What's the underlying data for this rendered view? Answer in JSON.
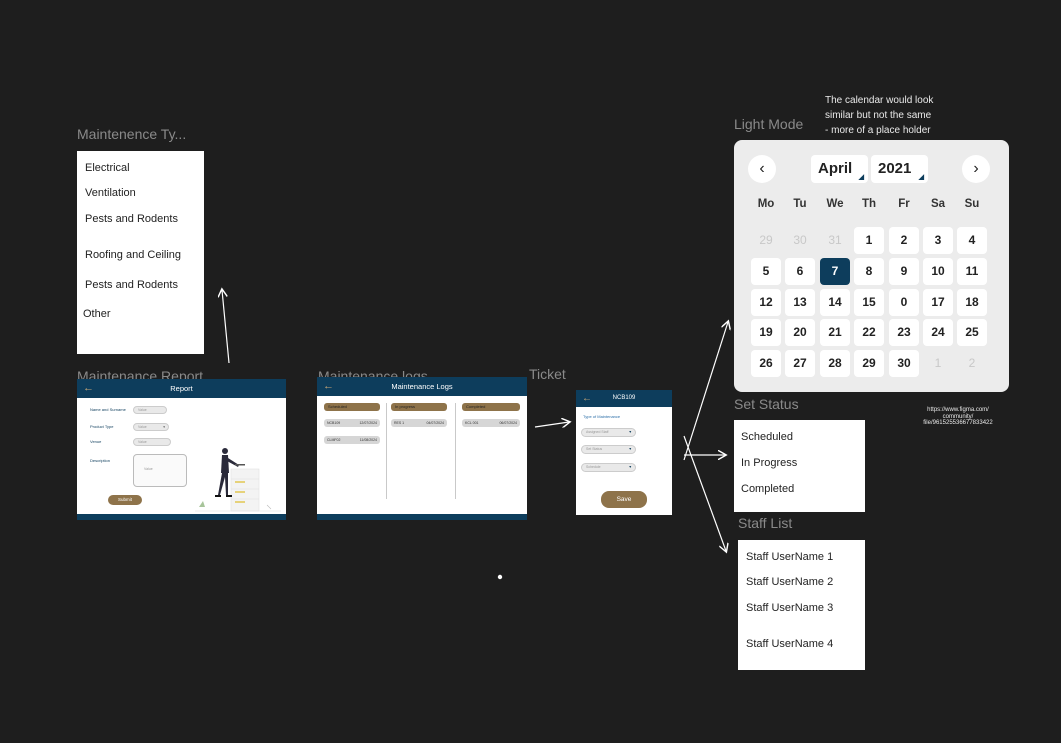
{
  "maintenance_types": {
    "title": "Maintenence Ty...",
    "items": [
      "Electrical",
      "Ventilation",
      "Pests and Rodents",
      "Roofing and Ceiling",
      "Pests and Rodents",
      "Other"
    ]
  },
  "report": {
    "section_label": "Maintenance Report",
    "header": "Report",
    "fields": [
      "Name and Surname",
      "Product Type",
      "Venue",
      "Description"
    ],
    "name_placeholder": "Value",
    "product_placeholder": "Value",
    "venue_placeholder": "Value",
    "description_placeholder": "Value",
    "submit": "Submit"
  },
  "logs": {
    "section_label": "Maintenance logs",
    "header": "Maintenance Logs",
    "columns": [
      {
        "title": "Scheduled",
        "rows": [
          {
            "id": "NCB109",
            "date": "12/07/2024"
          },
          {
            "id": "CLMF02",
            "date": "11/08/2024"
          }
        ]
      },
      {
        "title": "In progress",
        "rows": [
          {
            "id": "RES 1",
            "date": "04/07/2024"
          }
        ]
      },
      {
        "title": "Completed",
        "rows": [
          {
            "id": "KCL 001",
            "date": "06/07/2024"
          }
        ]
      }
    ]
  },
  "ticket": {
    "section_label": "Ticket",
    "header": "NCB109",
    "type_label": "Type of Maintenance",
    "selects": [
      "Assigned Staff",
      "Set Status",
      "Schedule"
    ],
    "save": "Save"
  },
  "calendar": {
    "note": [
      "The calendar would look",
      "similar but not the same",
      "- more of a place holder"
    ],
    "section_label": "Light Mode",
    "month": "April",
    "year": "2021",
    "prev_icon": "chevron-left-icon",
    "next_icon": "chevron-right-icon",
    "weekdays": [
      "Mo",
      "Tu",
      "We",
      "Th",
      "Fr",
      "Sa",
      "Su"
    ],
    "weeks": [
      [
        "29",
        "30",
        "31",
        "1",
        "2",
        "3",
        "4"
      ],
      [
        "5",
        "6",
        "7",
        "8",
        "9",
        "10",
        "11"
      ],
      [
        "12",
        "13",
        "14",
        "15",
        "0",
        "17",
        "18"
      ],
      [
        "19",
        "20",
        "21",
        "22",
        "23",
        "24",
        "25"
      ],
      [
        "26",
        "27",
        "28",
        "29",
        "30",
        "1",
        "2"
      ]
    ],
    "selected": "7",
    "selected_color": "#0d3d5c"
  },
  "set_status": {
    "section_label": "Set Status",
    "items": [
      "Scheduled",
      "In Progress",
      "Completed"
    ]
  },
  "staff_list": {
    "section_label": "Staff List",
    "items": [
      "Staff UserName 1",
      "Staff UserName 2",
      "Staff UserName 3",
      "Staff UserName 4"
    ]
  },
  "figma_url": [
    "https://www.figma.com/",
    "community/",
    "file/961525536677833422"
  ],
  "colors": {
    "canvas": "#1e1e1e",
    "navy": "#0d3d5c",
    "brown": "#8e734a"
  }
}
